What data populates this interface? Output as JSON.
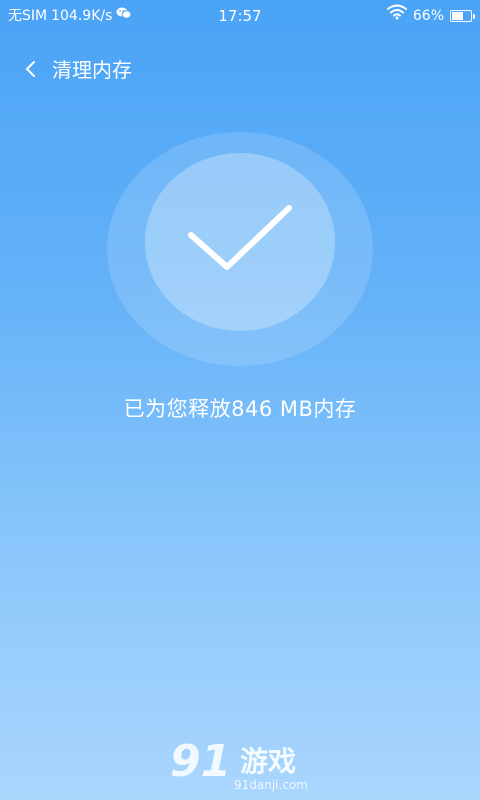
{
  "status_bar": {
    "carrier": "无SIM",
    "speed": "104.9K/s",
    "time": "17:57",
    "battery": "66%",
    "battery_level": 0.66,
    "icons": [
      "wechat-icon",
      "wifi-icon",
      "battery-icon"
    ]
  },
  "header": {
    "title": "清理内存",
    "back_icon": "chevron-left-icon"
  },
  "result": {
    "icon": "checkmark-icon",
    "message": "已为您释放846 MB内存"
  },
  "watermark": {
    "logo": "91",
    "name": "游戏",
    "url": "91danji.com"
  },
  "colors": {
    "background_top": "#4aa3f6",
    "background_bottom": "#a9d6fd",
    "text": "#ffffff"
  }
}
